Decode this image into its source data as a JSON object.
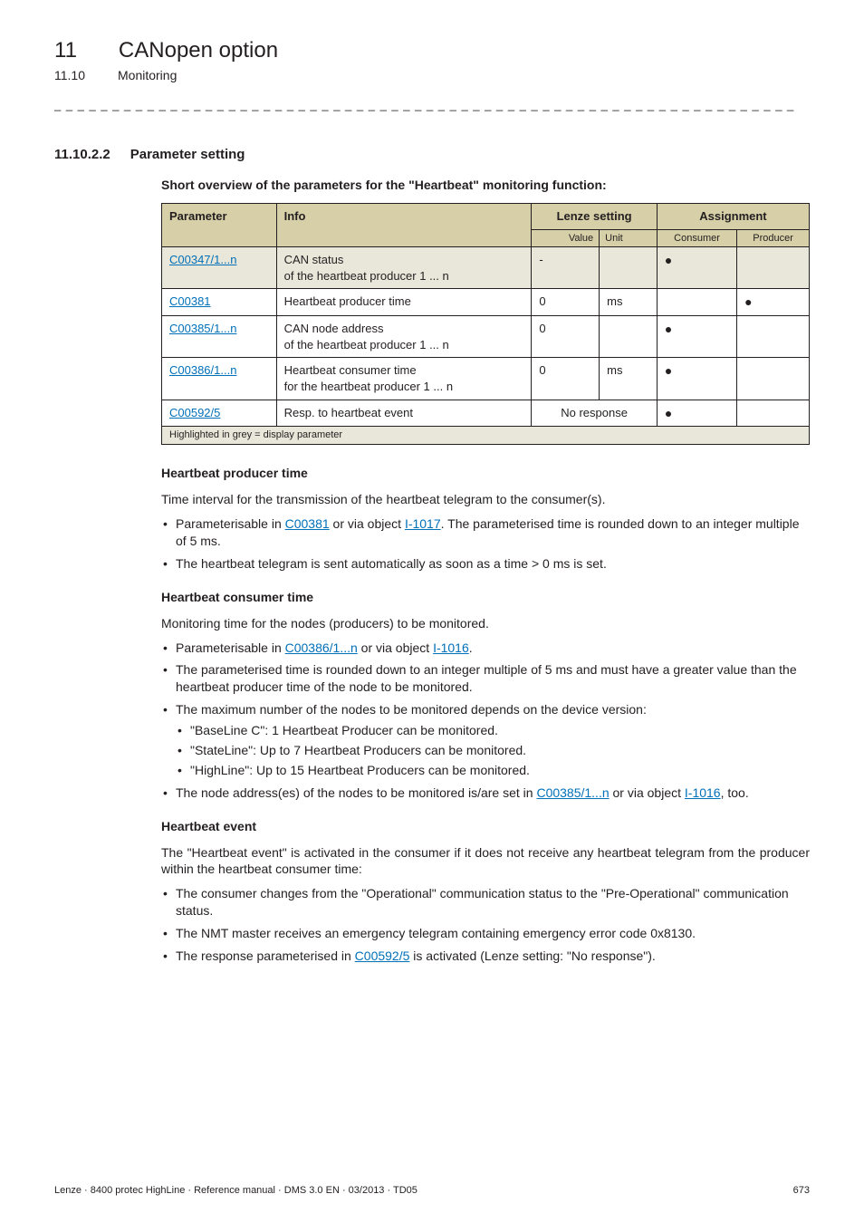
{
  "header": {
    "chapter_num": "11",
    "chapter_title": "CANopen option",
    "section_num": "11.10",
    "section_title": "Monitoring",
    "divider": "_ _ _ _ _ _ _ _ _ _ _ _ _ _ _ _ _ _ _ _ _ _ _ _ _ _ _ _ _ _ _ _ _ _ _ _ _ _ _ _ _ _ _ _ _ _ _ _ _ _ _ _ _ _ _ _ _ _ _ _ _ _ _ _"
  },
  "h3": {
    "num": "11.10.2.2",
    "title": "Parameter setting"
  },
  "table": {
    "caption": "Short overview of the parameters for the \"Heartbeat\" monitoring function:",
    "head": {
      "parameter": "Parameter",
      "info": "Info",
      "lenze": "Lenze setting",
      "assignment": "Assignment",
      "value": "Value",
      "unit": "Unit",
      "consumer": "Consumer",
      "producer": "Producer"
    },
    "rows": [
      {
        "p": "C00347/1...n",
        "info": "CAN status\nof the heartbeat producer 1 ... n",
        "value": "-",
        "unit": "",
        "consumer": "●",
        "producer": "",
        "display": true
      },
      {
        "p": "C00381",
        "info": "Heartbeat producer time",
        "value": "0",
        "unit": "ms",
        "consumer": "",
        "producer": "●"
      },
      {
        "p": "C00385/1...n",
        "info": "CAN node address\nof the heartbeat producer 1 ... n",
        "value": "0",
        "unit": "",
        "consumer": "●",
        "producer": ""
      },
      {
        "p": "C00386/1...n",
        "info": "Heartbeat consumer time\nfor the heartbeat producer 1 ... n",
        "value": "0",
        "unit": "ms",
        "consumer": "●",
        "producer": ""
      },
      {
        "p": "C00592/5",
        "info": "Resp. to heartbeat event",
        "value_span": "No response",
        "consumer": "●",
        "producer": ""
      }
    ],
    "footnote": "Highlighted in grey = display parameter"
  },
  "hb_producer": {
    "title": "Heartbeat producer time",
    "intro": "Time interval for the transmission of the heartbeat telegram to the consumer(s).",
    "b1_a": "Parameterisable in ",
    "b1_l1": "C00381",
    "b1_b": " or via object ",
    "b1_l2": "I-1017",
    "b1_c": ". The parameterised time is rounded down to an integer multiple of 5 ms.",
    "b2": "The heartbeat telegram is sent automatically as soon as a time > 0 ms is set."
  },
  "hb_consumer": {
    "title": "Heartbeat consumer time",
    "intro": "Monitoring time for the nodes (producers) to be monitored.",
    "b1_a": "Parameterisable in ",
    "b1_l1": "C00386/1...n",
    "b1_b": " or via object ",
    "b1_l2": "I-1016",
    "b1_c": ".",
    "b2": "The parameterised time is rounded down to an integer multiple of 5 ms and must have a greater value than the heartbeat producer time of the node to be monitored.",
    "b3": "The maximum number of the nodes to be monitored depends on the device version:",
    "b3s1": "\"BaseLine C\": 1 Heartbeat Producer can be monitored.",
    "b3s2": "\"StateLine\": Up to 7 Heartbeat Producers can be monitored.",
    "b3s3": "\"HighLine\": Up to 15 Heartbeat Producers can be monitored.",
    "b4_a": "The node address(es) of the nodes to be monitored is/are set in ",
    "b4_l1": "C00385/1...n",
    "b4_b": " or via object ",
    "b4_l2": "I-1016",
    "b4_c": ", too."
  },
  "hb_event": {
    "title": "Heartbeat event",
    "intro": "The \"Heartbeat event\" is activated in the consumer if it does not receive any heartbeat telegram from the producer within the heartbeat consumer time:",
    "b1": "The consumer changes from the \"Operational\" communication status to the \"Pre-Operational\" communication status.",
    "b2": "The NMT master receives an emergency telegram containing emergency error code 0x8130.",
    "b3_a": "The response parameterised in ",
    "b3_l1": "C00592/5",
    "b3_b": " is activated (Lenze setting: \"No response\")."
  },
  "footer": {
    "left": "Lenze · 8400 protec HighLine · Reference manual · DMS 3.0 EN · 03/2013 · TD05",
    "right": "673"
  }
}
